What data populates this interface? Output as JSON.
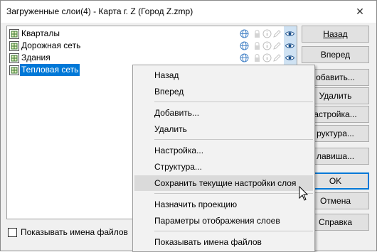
{
  "window": {
    "title": "Загруженные слои(4) - Карта г. Z (Город Z.zmp)",
    "close_glyph": "✕"
  },
  "layers": [
    {
      "name": "Кварталы",
      "selected": false
    },
    {
      "name": "Дорожная сеть",
      "selected": false
    },
    {
      "name": "Здания",
      "selected": false
    },
    {
      "name": "Тепловая сеть",
      "selected": true
    }
  ],
  "buttons": {
    "back": "Назад",
    "forward": "Вперед",
    "add": "обавить...",
    "delete": "Удалить",
    "settings": "астройка...",
    "structure": "руктура...",
    "hotkeys": "лавиша...",
    "ok": "OK",
    "cancel": "Отмена",
    "help": "Справка"
  },
  "show_filenames": {
    "label": "Показывать имена файлов",
    "checked": false
  },
  "context_menu": {
    "items": [
      {
        "label": "Назад"
      },
      {
        "label": "Вперед"
      },
      {
        "label": "Добавить..."
      },
      {
        "label": "Удалить"
      },
      {
        "label": "Настройка..."
      },
      {
        "label": "Структура..."
      },
      {
        "label": "Сохранить текущие настройки слоя"
      },
      {
        "label": "Назначить проекцию"
      },
      {
        "label": "Параметры отображения слоев"
      },
      {
        "label": "Показывать имена файлов"
      }
    ],
    "hovered_index": 6
  },
  "colors": {
    "selection": "#0078d7",
    "menu_hover": "#dadada",
    "eye_column": "#cfe2f3",
    "globe_icon": "#4a86c8"
  },
  "icons": {
    "layer": "layer-map-icon",
    "globe": "globe-icon",
    "lock": "lock-icon",
    "info": "info-icon",
    "edit": "pencil-icon",
    "visible": "eye-icon"
  }
}
